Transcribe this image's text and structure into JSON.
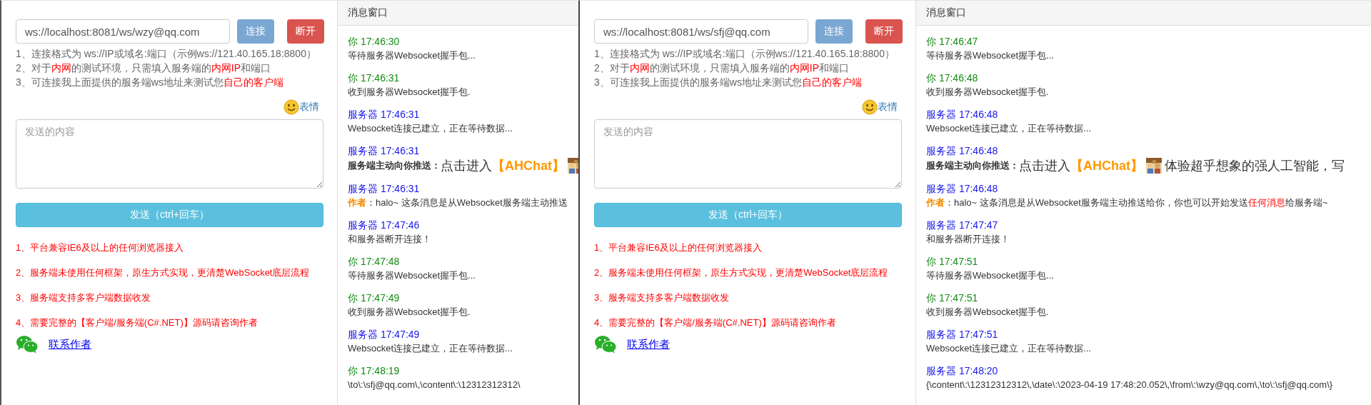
{
  "windows": [
    {
      "url": "ws://localhost:8081/ws/wzy@qq.com",
      "connect_label": "连接",
      "disconnect_label": "断开",
      "hints": [
        [
          {
            "text": "1、连接格式为 ws://IP或域名:端口（示例ws://121.40.165.18:8800）",
            "highlight": false
          }
        ],
        [
          {
            "text": "2、对于",
            "highlight": false
          },
          {
            "text": "内网",
            "highlight": true
          },
          {
            "text": "的测试环境，只需填入服务端的",
            "highlight": false
          },
          {
            "text": "内网IP",
            "highlight": true
          },
          {
            "text": "和端口",
            "highlight": false
          }
        ],
        [
          {
            "text": "3、可连接我上面提供的服务端ws地址来测试您",
            "highlight": false
          },
          {
            "text": "自己的客户端",
            "highlight": true
          }
        ]
      ],
      "emoji_label": "表情",
      "placeholder": "发送的内容",
      "send_label": "发送（ctrl+回车）",
      "features": [
        "1、平台兼容IE6及以上的任何浏览器接入",
        "2、服务端未使用任何框架，原生方式实现，更清楚WebSocket底层流程",
        "3、服务端支持多客户端数据收发",
        "4、需要完整的【客户端/服务端(C#.NET)】源码请咨询作者"
      ],
      "contact_label": "联系作者",
      "message_window_title": "消息窗口",
      "messages": [
        {
          "from_server": false,
          "sender": "你",
          "time": "17:46:30",
          "kind": "text",
          "text": "等待服务器Websocket握手包..."
        },
        {
          "from_server": false,
          "sender": "你",
          "time": "17:46:31",
          "kind": "text",
          "text": "收到服务器Websocket握手包."
        },
        {
          "from_server": true,
          "sender": "服务器",
          "time": "17:46:31",
          "kind": "text",
          "text": "Websocket连接已建立，正在等待数据..."
        },
        {
          "from_server": true,
          "sender": "服务器",
          "time": "17:46:31",
          "kind": "push",
          "label": "服务端主动向你推送：",
          "link": "点击进入",
          "brand": "【AHChat】",
          "has_image": true
        },
        {
          "from_server": true,
          "sender": "服务器",
          "time": "17:46:31",
          "kind": "author",
          "label": "作者",
          "text": "：halo~ 这条消息是从Websocket服务端主动推送"
        },
        {
          "from_server": true,
          "sender": "服务器",
          "time": "17:47:46",
          "kind": "text",
          "text": "和服务器断开连接！"
        },
        {
          "from_server": false,
          "sender": "你",
          "time": "17:47:48",
          "kind": "text",
          "text": "等待服务器Websocket握手包..."
        },
        {
          "from_server": false,
          "sender": "你",
          "time": "17:47:49",
          "kind": "text",
          "text": "收到服务器Websocket握手包."
        },
        {
          "from_server": true,
          "sender": "服务器",
          "time": "17:47:49",
          "kind": "text",
          "text": "Websocket连接已建立，正在等待数据..."
        },
        {
          "from_server": false,
          "sender": "你",
          "time": "17:48:19",
          "kind": "text",
          "text": "\\to\\:\\sfj@qq.com\\,\\content\\:\\12312312312\\"
        }
      ]
    },
    {
      "url": "ws://localhost:8081/ws/sfj@qq.com",
      "connect_label": "连接",
      "disconnect_label": "断开",
      "hints": [
        [
          {
            "text": "1、连接格式为 ws://IP或域名:端口（示例ws://121.40.165.18:8800）",
            "highlight": false
          }
        ],
        [
          {
            "text": "2、对于",
            "highlight": false
          },
          {
            "text": "内网",
            "highlight": true
          },
          {
            "text": "的测试环境，只需填入服务端的",
            "highlight": false
          },
          {
            "text": "内网IP",
            "highlight": true
          },
          {
            "text": "和端口",
            "highlight": false
          }
        ],
        [
          {
            "text": "3、可连接我上面提供的服务端ws地址来测试您",
            "highlight": false
          },
          {
            "text": "自己的客户端",
            "highlight": true
          }
        ]
      ],
      "emoji_label": "表情",
      "placeholder": "发送的内容",
      "send_label": "发送（ctrl+回车）",
      "features": [
        "1、平台兼容IE6及以上的任何浏览器接入",
        "2、服务端未使用任何框架，原生方式实现，更清楚WebSocket底层流程",
        "3、服务端支持多客户端数据收发",
        "4、需要完整的【客户端/服务端(C#.NET)】源码请咨询作者"
      ],
      "contact_label": "联系作者",
      "message_window_title": "消息窗口",
      "messages": [
        {
          "from_server": false,
          "sender": "你",
          "time": "17:46:47",
          "kind": "text",
          "text": "等待服务器Websocket握手包..."
        },
        {
          "from_server": false,
          "sender": "你",
          "time": "17:46:48",
          "kind": "text",
          "text": "收到服务器Websocket握手包."
        },
        {
          "from_server": true,
          "sender": "服务器",
          "time": "17:46:48",
          "kind": "text",
          "text": "Websocket连接已建立，正在等待数据..."
        },
        {
          "from_server": true,
          "sender": "服务器",
          "time": "17:46:48",
          "kind": "push",
          "label": "服务端主动向你推送：",
          "link": "点击进入",
          "brand": "【AHChat】",
          "has_image": true,
          "tail": "体验超乎想象的强人工智能，写"
        },
        {
          "from_server": true,
          "sender": "服务器",
          "time": "17:46:48",
          "kind": "author",
          "label": "作者",
          "text": "：halo~ 这条消息是从Websocket服务端主动推送给你，你也可以开始发送",
          "highlight": "任何消息",
          "after": "给服务端~"
        },
        {
          "from_server": true,
          "sender": "服务器",
          "time": "17:47:47",
          "kind": "text",
          "text": "和服务器断开连接！"
        },
        {
          "from_server": false,
          "sender": "你",
          "time": "17:47:51",
          "kind": "text",
          "text": "等待服务器Websocket握手包..."
        },
        {
          "from_server": false,
          "sender": "你",
          "time": "17:47:51",
          "kind": "text",
          "text": "收到服务器Websocket握手包."
        },
        {
          "from_server": true,
          "sender": "服务器",
          "time": "17:47:51",
          "kind": "text",
          "text": "Websocket连接已建立，正在等待数据..."
        },
        {
          "from_server": true,
          "sender": "服务器",
          "time": "17:48:20",
          "kind": "text",
          "text": "{\\content\\:\\12312312312\\,\\date\\:\\2023-04-19 17:48:20.052\\,\\from\\:\\wzy@qq.com\\,\\to\\:\\sfj@qq.com\\}"
        }
      ]
    }
  ]
}
